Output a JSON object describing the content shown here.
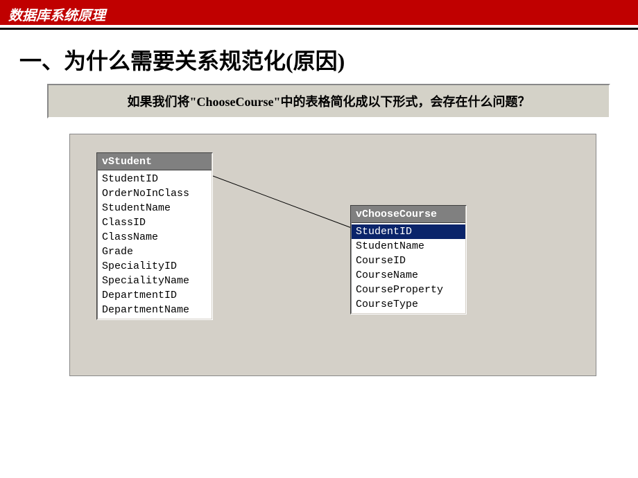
{
  "header": {
    "title": "数据库系统原理"
  },
  "main_title": "一、为什么需要关系规范化(原因)",
  "question": "如果我们将\"ChooseCourse\"中的表格简化成以下形式，会存在什么问题？",
  "tables": {
    "vStudent": {
      "name": "vStudent",
      "fields": [
        "StudentID",
        "OrderNoInClass",
        "StudentName",
        "ClassID",
        "ClassName",
        "Grade",
        "SpecialityID",
        "SpecialityName",
        "DepartmentID",
        "DepartmentName"
      ]
    },
    "vChooseCourse": {
      "name": "vChooseCourse",
      "fields": [
        "StudentID",
        "StudentName",
        "CourseID",
        "CourseName",
        "CourseProperty",
        "CourseType"
      ],
      "selected_index": 0
    }
  }
}
